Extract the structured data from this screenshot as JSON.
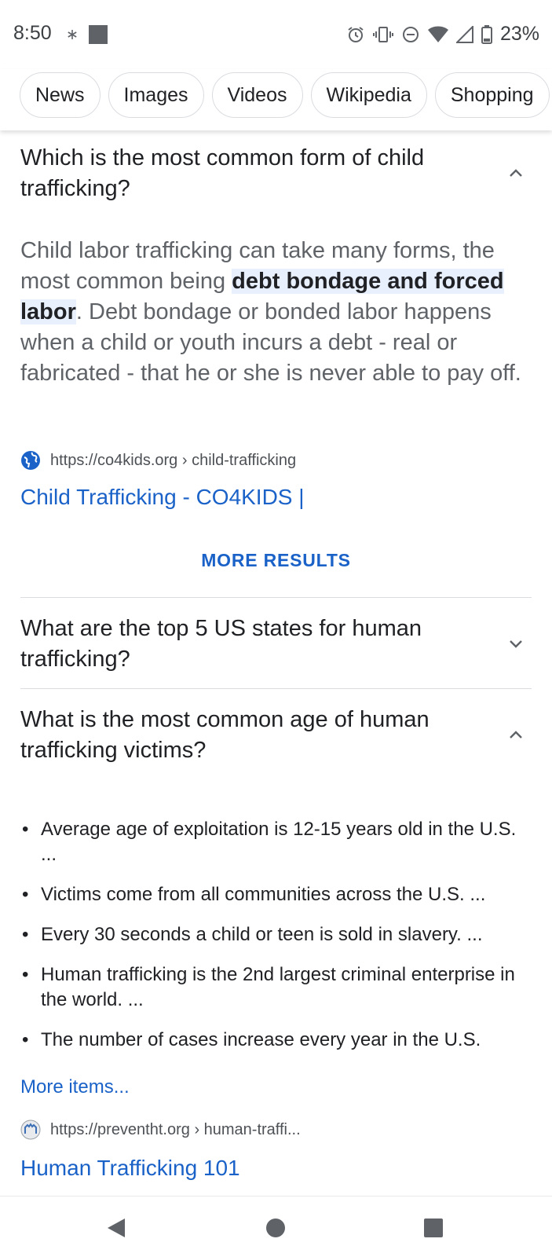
{
  "status": {
    "time": "8:50",
    "battery": "23%"
  },
  "chips": [
    "News",
    "Images",
    "Videos",
    "Wikipedia",
    "Shopping"
  ],
  "faq1": {
    "question": "Which is the most common form of child trafficking?",
    "answer_before": "Child labor trafficking can take many forms, the most common being ",
    "answer_highlight": "debt bondage and forced labor",
    "answer_after": ". Debt bondage or bonded labor happens when a child or youth incurs a debt - real or fabricated - that he or she is never able to pay off.",
    "source_url": "https://co4kids.org › child-trafficking",
    "link_title": "Child Trafficking - CO4KIDS |"
  },
  "more_results": "MORE RESULTS",
  "faq2": {
    "question": "What are the top 5 US states for human trafficking?"
  },
  "faq3": {
    "question": "What is the most common age of human trafficking victims?",
    "bullets": [
      "Average age of exploitation is 12-15 years old in the U.S. ...",
      "Victims come from all communities across the U.S. ...",
      "Every 30 seconds a child or teen is sold in slavery. ...",
      "Human trafficking is the 2nd largest criminal enterprise in the world. ...",
      "The number of cases increase every year in the U.S."
    ],
    "more_items": "More items...",
    "source_url": "https://preventht.org › human-traffi...",
    "link_title": "Human Trafficking 101"
  },
  "icons": {
    "status": [
      "asterisk-icon",
      "square-notification-icon",
      "alarm-icon",
      "vibrate-icon",
      "dnd-icon",
      "wifi-icon",
      "signal-icon",
      "battery-icon"
    ],
    "nav": [
      "back-icon",
      "home-icon",
      "recents-icon"
    ]
  },
  "colors": {
    "link": "#1a62c8",
    "highlight_bg": "#e8f0fe",
    "text": "#202124",
    "muted": "#5f6368"
  }
}
